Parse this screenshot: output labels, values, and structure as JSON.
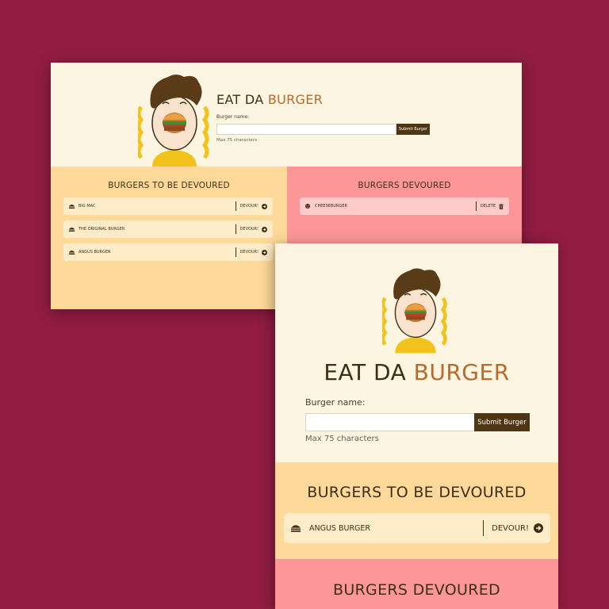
{
  "colors": {
    "background": "#921c42",
    "cream": "#fcf5e2",
    "pending": "#fed999",
    "devoured": "#fd9797",
    "accent": "#b96a2a",
    "dark": "#3e2e14",
    "button": "#4e3614"
  },
  "header": {
    "title_main": "EAT DA ",
    "title_accent": "BURGER",
    "burger_label": "Burger name:",
    "submit_label": "Submit Burger",
    "hint": "Max 75 characters"
  },
  "desktop": {
    "to_devour": {
      "title": "BURGERS TO BE DEVOURED",
      "items": [
        {
          "name": "BIG MAC",
          "action": "DEVOUR!",
          "icon": "burger-icon"
        },
        {
          "name": "THE ORIGINAL BURGER",
          "action": "DEVOUR!",
          "icon": "burger-icon"
        },
        {
          "name": "ANGUS BURGER",
          "action": "DEVOUR!",
          "icon": "burger-icon"
        }
      ]
    },
    "devoured": {
      "title": "BURGERS DEVOURED",
      "items": [
        {
          "name": "CHEESEBURGER",
          "action": "DELETE",
          "icon": "smiley-icon"
        }
      ]
    }
  },
  "mobile": {
    "to_devour": {
      "title": "BURGERS TO BE DEVOURED",
      "items": [
        {
          "name": "ANGUS BURGER",
          "action": "DEVOUR!",
          "icon": "burger-icon"
        }
      ]
    },
    "devoured": {
      "title": "BURGERS DEVOURED"
    }
  }
}
